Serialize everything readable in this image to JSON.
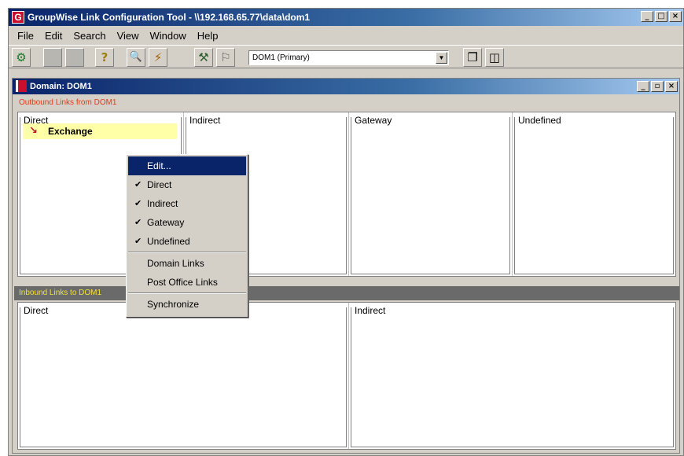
{
  "window": {
    "title": "GroupWise Link Configuration Tool - \\\\192.168.65.77\\data\\dom1",
    "app_icon_glyph": "G",
    "controls": [
      "_",
      "□",
      "×"
    ]
  },
  "menubar": [
    "File",
    "Edit",
    "Search",
    "View",
    "Window",
    "Help"
  ],
  "toolbar": {
    "buttons": [
      {
        "icon": "connect-icon",
        "glyph": "⚙"
      },
      {
        "icon": "disabled-icon-1",
        "glyph": ""
      },
      {
        "icon": "disabled-icon-2",
        "glyph": ""
      },
      {
        "icon": "help-icon",
        "glyph": "?"
      },
      {
        "icon": "find-icon",
        "glyph": "🔍"
      },
      {
        "icon": "link-tool-icon",
        "glyph": "⚡"
      },
      {
        "icon": "tree-icon",
        "glyph": "⚒"
      },
      {
        "icon": "edit-link-icon",
        "glyph": "⚐"
      }
    ],
    "domain_select_value": "DOM1  (Primary)",
    "layout_buttons": [
      {
        "icon": "cascade-icon",
        "glyph": "❐"
      },
      {
        "icon": "tile-icon",
        "glyph": "◫"
      }
    ]
  },
  "child_window": {
    "title": "Domain: DOM1",
    "controls": [
      "_",
      "▫",
      "×"
    ],
    "outbound_label": "Outbound Links from DOM1",
    "inbound_label": "Inbound Links to DOM1",
    "outbound_groups": [
      "Direct",
      "Indirect",
      "Gateway",
      "Undefined"
    ],
    "inbound_groups": [
      "Direct",
      "Indirect"
    ],
    "outbound_items": [
      {
        "label": "Exchange",
        "icon": "link-connector-icon"
      }
    ]
  },
  "context_menu": {
    "items": [
      {
        "label": "Edit...",
        "checked": false,
        "selected": true
      },
      {
        "label": "Direct",
        "checked": true
      },
      {
        "label": "Indirect",
        "checked": true
      },
      {
        "label": "Gateway",
        "checked": true
      },
      {
        "label": "Undefined",
        "checked": true
      },
      {
        "sep": true
      },
      {
        "label": "Domain Links",
        "checked": false
      },
      {
        "label": "Post Office Links",
        "checked": false
      },
      {
        "sep": true
      },
      {
        "label": "Synchronize",
        "checked": false
      }
    ]
  },
  "colors": {
    "titlebar": "#0a246a",
    "outbound_label": "#e03a1a",
    "inbound_label": "#f0e040",
    "highlight_item": "#ffffa8",
    "menu_selection": "#0a246a"
  }
}
